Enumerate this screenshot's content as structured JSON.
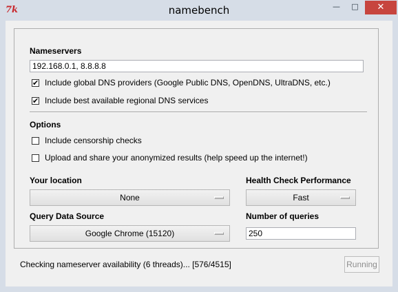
{
  "window": {
    "title": "namebench",
    "icon": "tk-feather-icon",
    "icon_text": "7k",
    "controls": {
      "minimize": "—",
      "maximize": "□",
      "close": "✕"
    }
  },
  "nameservers": {
    "label": "Nameservers",
    "value": "192.168.0.1, 8.8.8.8",
    "include_global": {
      "label": "Include global DNS providers (Google Public DNS, OpenDNS, UltraDNS, etc.)",
      "checked": true,
      "mark": "✔"
    },
    "include_regional": {
      "label": "Include best available regional DNS services",
      "checked": true,
      "mark": "✔"
    }
  },
  "options": {
    "label": "Options",
    "censorship": {
      "label": "Include censorship checks",
      "checked": false,
      "mark": ""
    },
    "upload": {
      "label": "Upload and share your anonymized results (help speed up the internet!)",
      "checked": false,
      "mark": ""
    }
  },
  "location": {
    "label": "Your location",
    "selected": "None"
  },
  "health": {
    "label": "Health Check Performance",
    "selected": "Fast"
  },
  "query_source": {
    "label": "Query Data Source",
    "selected": "Google Chrome (15120)"
  },
  "num_queries": {
    "label": "Number of queries",
    "value": "250"
  },
  "status": {
    "text": "Checking nameserver availability (6 threads)... [576/4515]"
  },
  "running_button": {
    "label": "Running",
    "enabled": false
  }
}
